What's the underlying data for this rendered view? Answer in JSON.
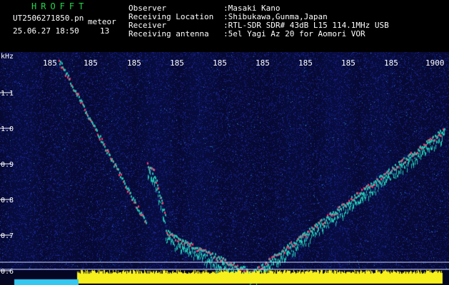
{
  "app": {
    "title": "HROFFT"
  },
  "capture": {
    "filename": "UT2506271850.pn",
    "mode": "meteor",
    "datetime": "25.06.27 18:50",
    "count": "13"
  },
  "info": [
    {
      "label": "Observer",
      "value": ":Masaki Kano"
    },
    {
      "label": "Receiving Location",
      "value": ":Shibukawa,Gunma,Japan"
    },
    {
      "label": "Receiver",
      "value": ":RTL-SDR SDR# 43dB L15 114.1MHz USB"
    },
    {
      "label": "Receiving antenna",
      "value": ":5el Yagi Az 20 for Aomori VOR"
    }
  ],
  "axis": {
    "y_unit": "kHz",
    "y_ticks": [
      "1.1",
      "1.0",
      "0.9",
      "0.8",
      "0.7",
      "0.6"
    ],
    "x_ticks": [
      "185",
      "185",
      "185",
      "185",
      "185",
      "185",
      "185",
      "185",
      "185",
      "1900"
    ]
  },
  "colors": {
    "background": "#000000",
    "title": "#22d84a",
    "text": "#ffffff",
    "noise": "#101a7a",
    "trace_high": "#ff3b6a",
    "trace_mid": "#22c8b4",
    "level_bar": "#f8f01c",
    "baseline": "#34c8f0"
  }
}
